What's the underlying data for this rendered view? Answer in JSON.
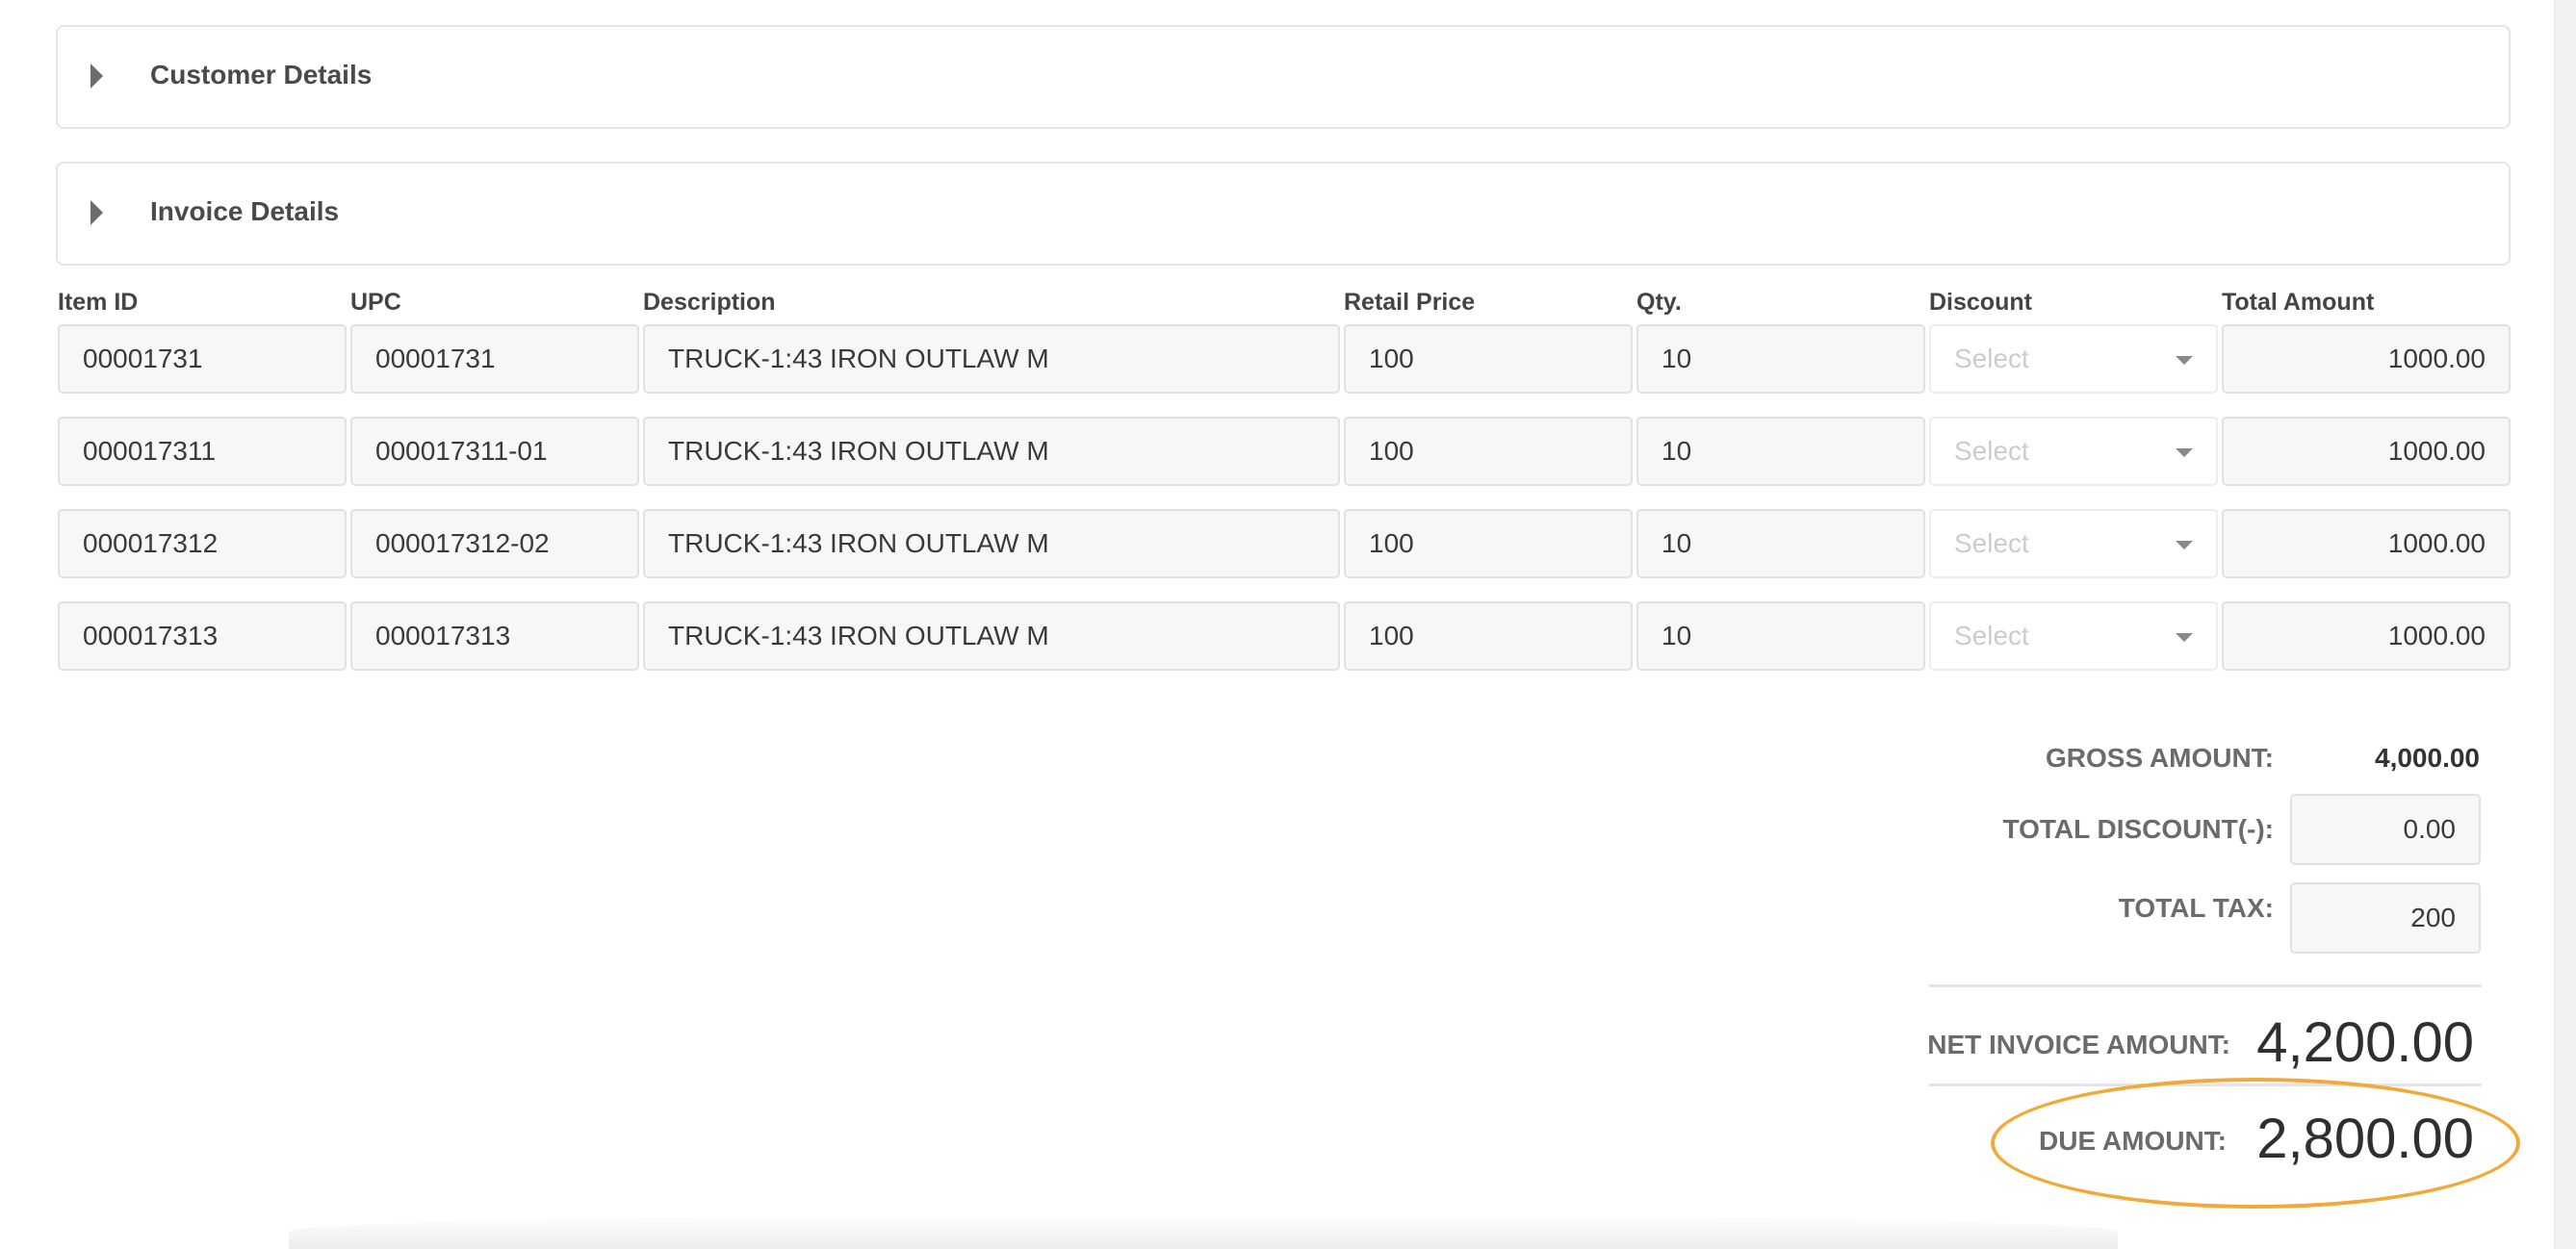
{
  "sections": {
    "customer": {
      "title": "Customer Details"
    },
    "invoice": {
      "title": "Invoice Details"
    }
  },
  "columns": [
    "Item ID",
    "UPC",
    "Description",
    "Retail Price",
    "Qty.",
    "Discount",
    "Total Amount"
  ],
  "rows": [
    {
      "item_id": "00001731",
      "upc": "00001731",
      "description": "TRUCK-1:43 IRON OUTLAW M",
      "retail_price": "100",
      "qty": "10",
      "discount": "Select",
      "total": "1000.00"
    },
    {
      "item_id": "000017311",
      "upc": "000017311-01",
      "description": "TRUCK-1:43 IRON OUTLAW M",
      "retail_price": "100",
      "qty": "10",
      "discount": "Select",
      "total": "1000.00"
    },
    {
      "item_id": "000017312",
      "upc": "000017312-02",
      "description": "TRUCK-1:43 IRON OUTLAW M",
      "retail_price": "100",
      "qty": "10",
      "discount": "Select",
      "total": "1000.00"
    },
    {
      "item_id": "000017313",
      "upc": "000017313",
      "description": "TRUCK-1:43 IRON OUTLAW M",
      "retail_price": "100",
      "qty": "10",
      "discount": "Select",
      "total": "1000.00"
    }
  ],
  "summary": {
    "gross_label": "GROSS AMOUNT:",
    "gross_value": "4,000.00",
    "discount_label": "TOTAL DISCOUNT(-):",
    "discount_value": "0.00",
    "tax_label": "TOTAL TAX:",
    "tax_value": "200",
    "net_label": "NET INVOICE AMOUNT:",
    "net_value": "4,200.00",
    "due_label": "DUE AMOUNT:",
    "due_value": "2,800.00"
  },
  "colors": {
    "highlight": "#f0a93a",
    "border": "#dfe1e4",
    "field_bg": "#f6f7f8"
  },
  "icons": {
    "section_toggle": "caret-right-icon",
    "dropdown": "caret-down-icon"
  }
}
